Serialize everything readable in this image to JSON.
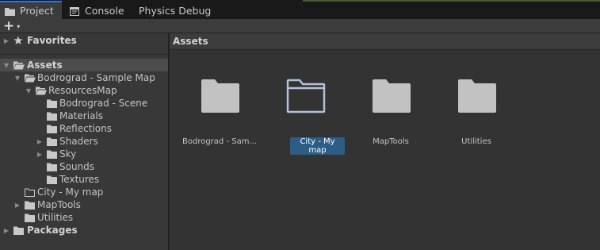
{
  "tabs": [
    {
      "label": "Project",
      "icon": "folder-icon",
      "active": true
    },
    {
      "label": "Console",
      "icon": "console-icon",
      "active": false
    },
    {
      "label": "Physics Debug",
      "active": false
    }
  ],
  "toolbar": {
    "add_label": "+",
    "add_caret": "▾"
  },
  "tree": {
    "favorites": "Favorites",
    "assets": "Assets",
    "bodrograd_sample": "Bodrograd - Sample Map",
    "resources_map": "ResourcesMap",
    "bodrograd_scene": "Bodrograd - Scene",
    "materials": "Materials",
    "reflections": "Reflections",
    "shaders": "Shaders",
    "sky": "Sky",
    "sounds": "Sounds",
    "textures": "Textures",
    "city_my_map": "City - My map",
    "map_tools": "MapTools",
    "utilities": "Utilities",
    "packages": "Packages"
  },
  "grid": {
    "title": "Assets",
    "items": [
      {
        "label": "Bodrograd - Sam...",
        "icon": "folder-icon",
        "selected": false
      },
      {
        "label": "City - My map",
        "icon": "folder-open-outline-icon",
        "selected": true
      },
      {
        "label": "MapTools",
        "icon": "folder-icon",
        "selected": false
      },
      {
        "label": "Utilities",
        "icon": "folder-icon",
        "selected": false
      }
    ]
  },
  "colors": {
    "selection": "#2c5d87",
    "tab_accent": "#3a72d0",
    "folder": "#c2c2c2"
  }
}
